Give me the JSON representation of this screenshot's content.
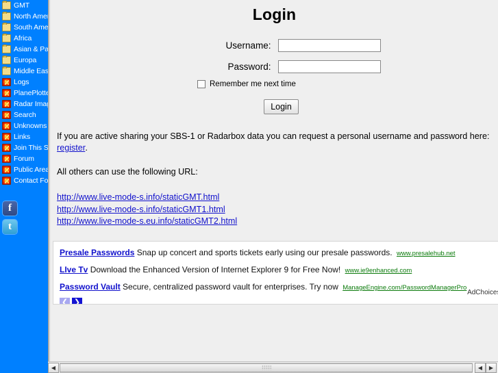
{
  "sidebar": {
    "background_color": "#0080FF",
    "folder_items": [
      {
        "label": "GMT",
        "icon": "folder-icon"
      },
      {
        "label": "North America",
        "icon": "folder-icon"
      },
      {
        "label": "South America",
        "icon": "folder-icon"
      },
      {
        "label": "Africa",
        "icon": "folder-icon"
      },
      {
        "label": "Asian & Pacific",
        "icon": "folder-icon"
      },
      {
        "label": "Europa",
        "icon": "folder-icon"
      },
      {
        "label": "Middle East",
        "icon": "folder-icon"
      }
    ],
    "link_items": [
      {
        "label": "Logs",
        "icon": "burst-icon"
      },
      {
        "label": "PlanePlotter Live",
        "icon": "burst-icon"
      },
      {
        "label": "Radar Images",
        "icon": "burst-icon"
      },
      {
        "label": "Search",
        "icon": "burst-icon"
      },
      {
        "label": "Unknowns",
        "icon": "burst-icon"
      },
      {
        "label": "Links",
        "icon": "burst-icon"
      },
      {
        "label": "Join This Site",
        "icon": "burst-icon"
      },
      {
        "label": "Forum",
        "icon": "burst-icon"
      },
      {
        "label": "Public Area",
        "icon": "burst-icon"
      },
      {
        "label": "Contact Form",
        "icon": "burst-icon"
      }
    ],
    "social": [
      {
        "name": "facebook-icon",
        "glyph": "f"
      },
      {
        "name": "twitter-icon",
        "glyph": "t"
      }
    ]
  },
  "main": {
    "title": "Login",
    "form": {
      "username_label": "Username:",
      "username_value": "",
      "username_placeholder": "",
      "password_label": "Password:",
      "password_value": "",
      "password_placeholder": "",
      "remember_label": "Remember me next time",
      "remember_checked": false,
      "submit_label": "Login"
    },
    "intro_text_before": "If you are active sharing your SBS-1 or Radarbox data you can request a personal username and password here: ",
    "intro_link": "register",
    "intro_text_after": ".",
    "others_text": "All others can use the following URL:",
    "urls": [
      "http://www.live-mode-s.info/staticGMT.html",
      "http://www.live-mode-s.info/staticGMT1.html",
      "http://www.live-mode-s.eu.info/staticGMT2.html"
    ]
  },
  "ads": {
    "items": [
      {
        "title": "Presale Passwords",
        "desc": "Snap up concert and sports tickets early using our presale passwords.",
        "url": "www.presalehub.net"
      },
      {
        "title": "LIve Tv",
        "desc": "Download the Enhanced Version of Internet Explorer 9 for Free Now!",
        "url": "www.ie9enhanced.com"
      },
      {
        "title": "Password Vault",
        "desc": "Secure, centralized password vault for enterprises. Try now",
        "url": "ManageEngine.com/PasswordManagerPro"
      }
    ],
    "prev_glyph": "❮",
    "next_glyph": "❯",
    "adchoices_label": "AdChoices [",
    "title_color": "#1111CC",
    "url_color": "#0A7A0A"
  },
  "scrollbar": {
    "left_glyph": "◀",
    "right_glyph": "▶"
  }
}
